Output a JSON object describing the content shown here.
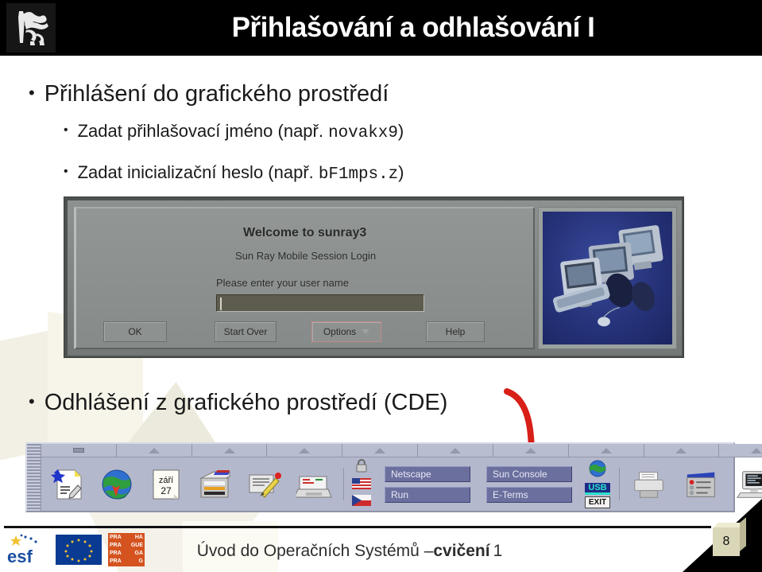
{
  "header": {
    "title": "Přihlašování a odhlašování I",
    "logo_name": "ctu-prague-lion-logo"
  },
  "bullets": {
    "b1": "Přihlášení do grafického prostředí",
    "b2_pre": "Zadat přihlašovací jméno (např. ",
    "b2_code": "novakx9",
    "b2_post": ")",
    "b3_pre": "Zadat inicializační heslo (např. ",
    "b3_code": "bF1mps.z",
    "b3_post": ")",
    "b4": "Odhlášení z grafického prostředí (CDE)",
    "marker": "•"
  },
  "login_dialog": {
    "welcome": "Welcome to sunray3",
    "subtitle": "Sun Ray Mobile Session Login",
    "prompt": "Please enter your user name",
    "input_value": "",
    "buttons": {
      "ok": "OK",
      "start_over": "Start Over",
      "options": "Options",
      "help": "Help"
    },
    "photo_panel_name": "sun-ray-terminals-photo"
  },
  "cde_panel": {
    "icons": [
      {
        "name": "text-editor-icon",
        "label": ""
      },
      {
        "name": "web-browser-globe-icon",
        "label": ""
      },
      {
        "name": "calendar-icon",
        "label": "",
        "month": "září",
        "day": "27"
      },
      {
        "name": "file-manager-icon",
        "label": ""
      },
      {
        "name": "notepad-icon",
        "label": ""
      },
      {
        "name": "mail-printer-icon",
        "label": ""
      },
      {
        "name": "printer-icon",
        "label": ""
      },
      {
        "name": "control-panel-icon",
        "label": ""
      },
      {
        "name": "terminal-workstation-icon",
        "label": ""
      },
      {
        "name": "help-books-icon",
        "label": "?"
      },
      {
        "name": "trash-can-icon",
        "label": ""
      }
    ],
    "small_icons": {
      "lock": "lock-icon",
      "flag_us": "us-flag-icon",
      "flag_cz": "cz-flag-icon",
      "globe": "globe-icon",
      "usb": "USB",
      "exit": "EXIT"
    },
    "session_buttons": [
      "Netscape",
      "Sun Console",
      "Run",
      "E-Terms"
    ]
  },
  "footer": {
    "course_plain": "Úvod do Operačních Systémů – ",
    "course_bold": "cvičení",
    "course_tail": " 1",
    "page_number": "8",
    "esf_text": "esf",
    "prague": [
      "PRA",
      "HA",
      "PRA",
      "GUE",
      "PRA",
      "GA",
      "PRA",
      "G"
    ]
  },
  "colors": {
    "header_bg": "#000000",
    "header_text": "#ffffff",
    "accent_red": "#d81f18",
    "cde_bg": "#b4b8cc",
    "cde_button": "#6b6f9e",
    "photo_bg": "#8d9190",
    "sunray_blue": "#26337a"
  }
}
